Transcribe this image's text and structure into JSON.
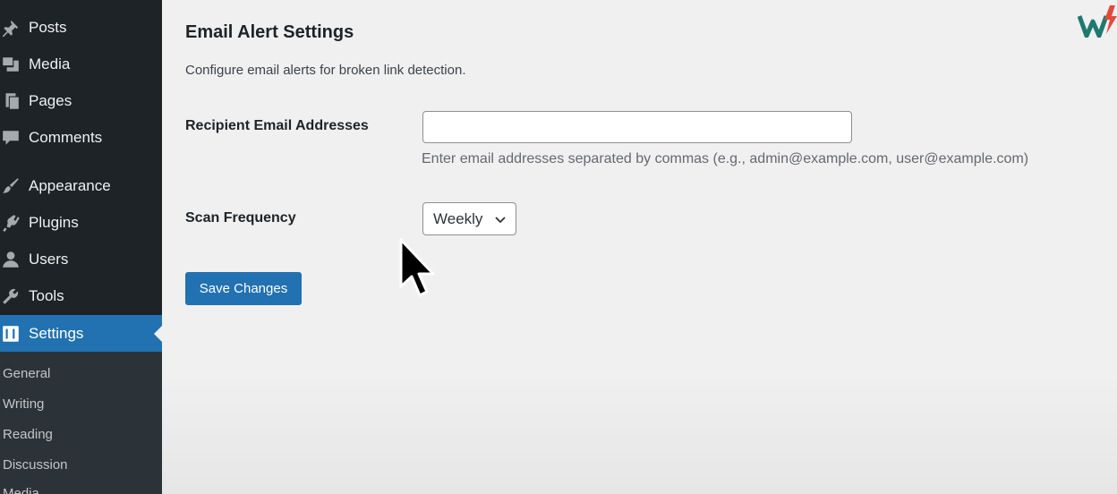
{
  "sidebar": {
    "items": [
      {
        "label": "Posts",
        "icon": "pin-icon"
      },
      {
        "label": "Media",
        "icon": "media-icon"
      },
      {
        "label": "Pages",
        "icon": "pages-icon"
      },
      {
        "label": "Comments",
        "icon": "comments-icon"
      },
      {
        "label": "Appearance",
        "icon": "brush-icon"
      },
      {
        "label": "Plugins",
        "icon": "plug-icon"
      },
      {
        "label": "Users",
        "icon": "user-icon"
      },
      {
        "label": "Tools",
        "icon": "wrench-icon"
      },
      {
        "label": "Settings",
        "icon": "settings-icon",
        "active": true
      }
    ],
    "submenu": [
      "General",
      "Writing",
      "Reading",
      "Discussion",
      "Media"
    ]
  },
  "main": {
    "title": "Email Alert Settings",
    "description": "Configure email alerts for broken link detection.",
    "recipients": {
      "label": "Recipient Email Addresses",
      "value": "",
      "help": "Enter email addresses separated by commas (e.g., admin@example.com, user@example.com)"
    },
    "frequency": {
      "label": "Scan Frequency",
      "selected": "Weekly"
    },
    "save_label": "Save Changes"
  },
  "colors": {
    "sidebar_bg": "#1d2327",
    "accent": "#2271b1",
    "page_bg": "#f0f0f1"
  }
}
